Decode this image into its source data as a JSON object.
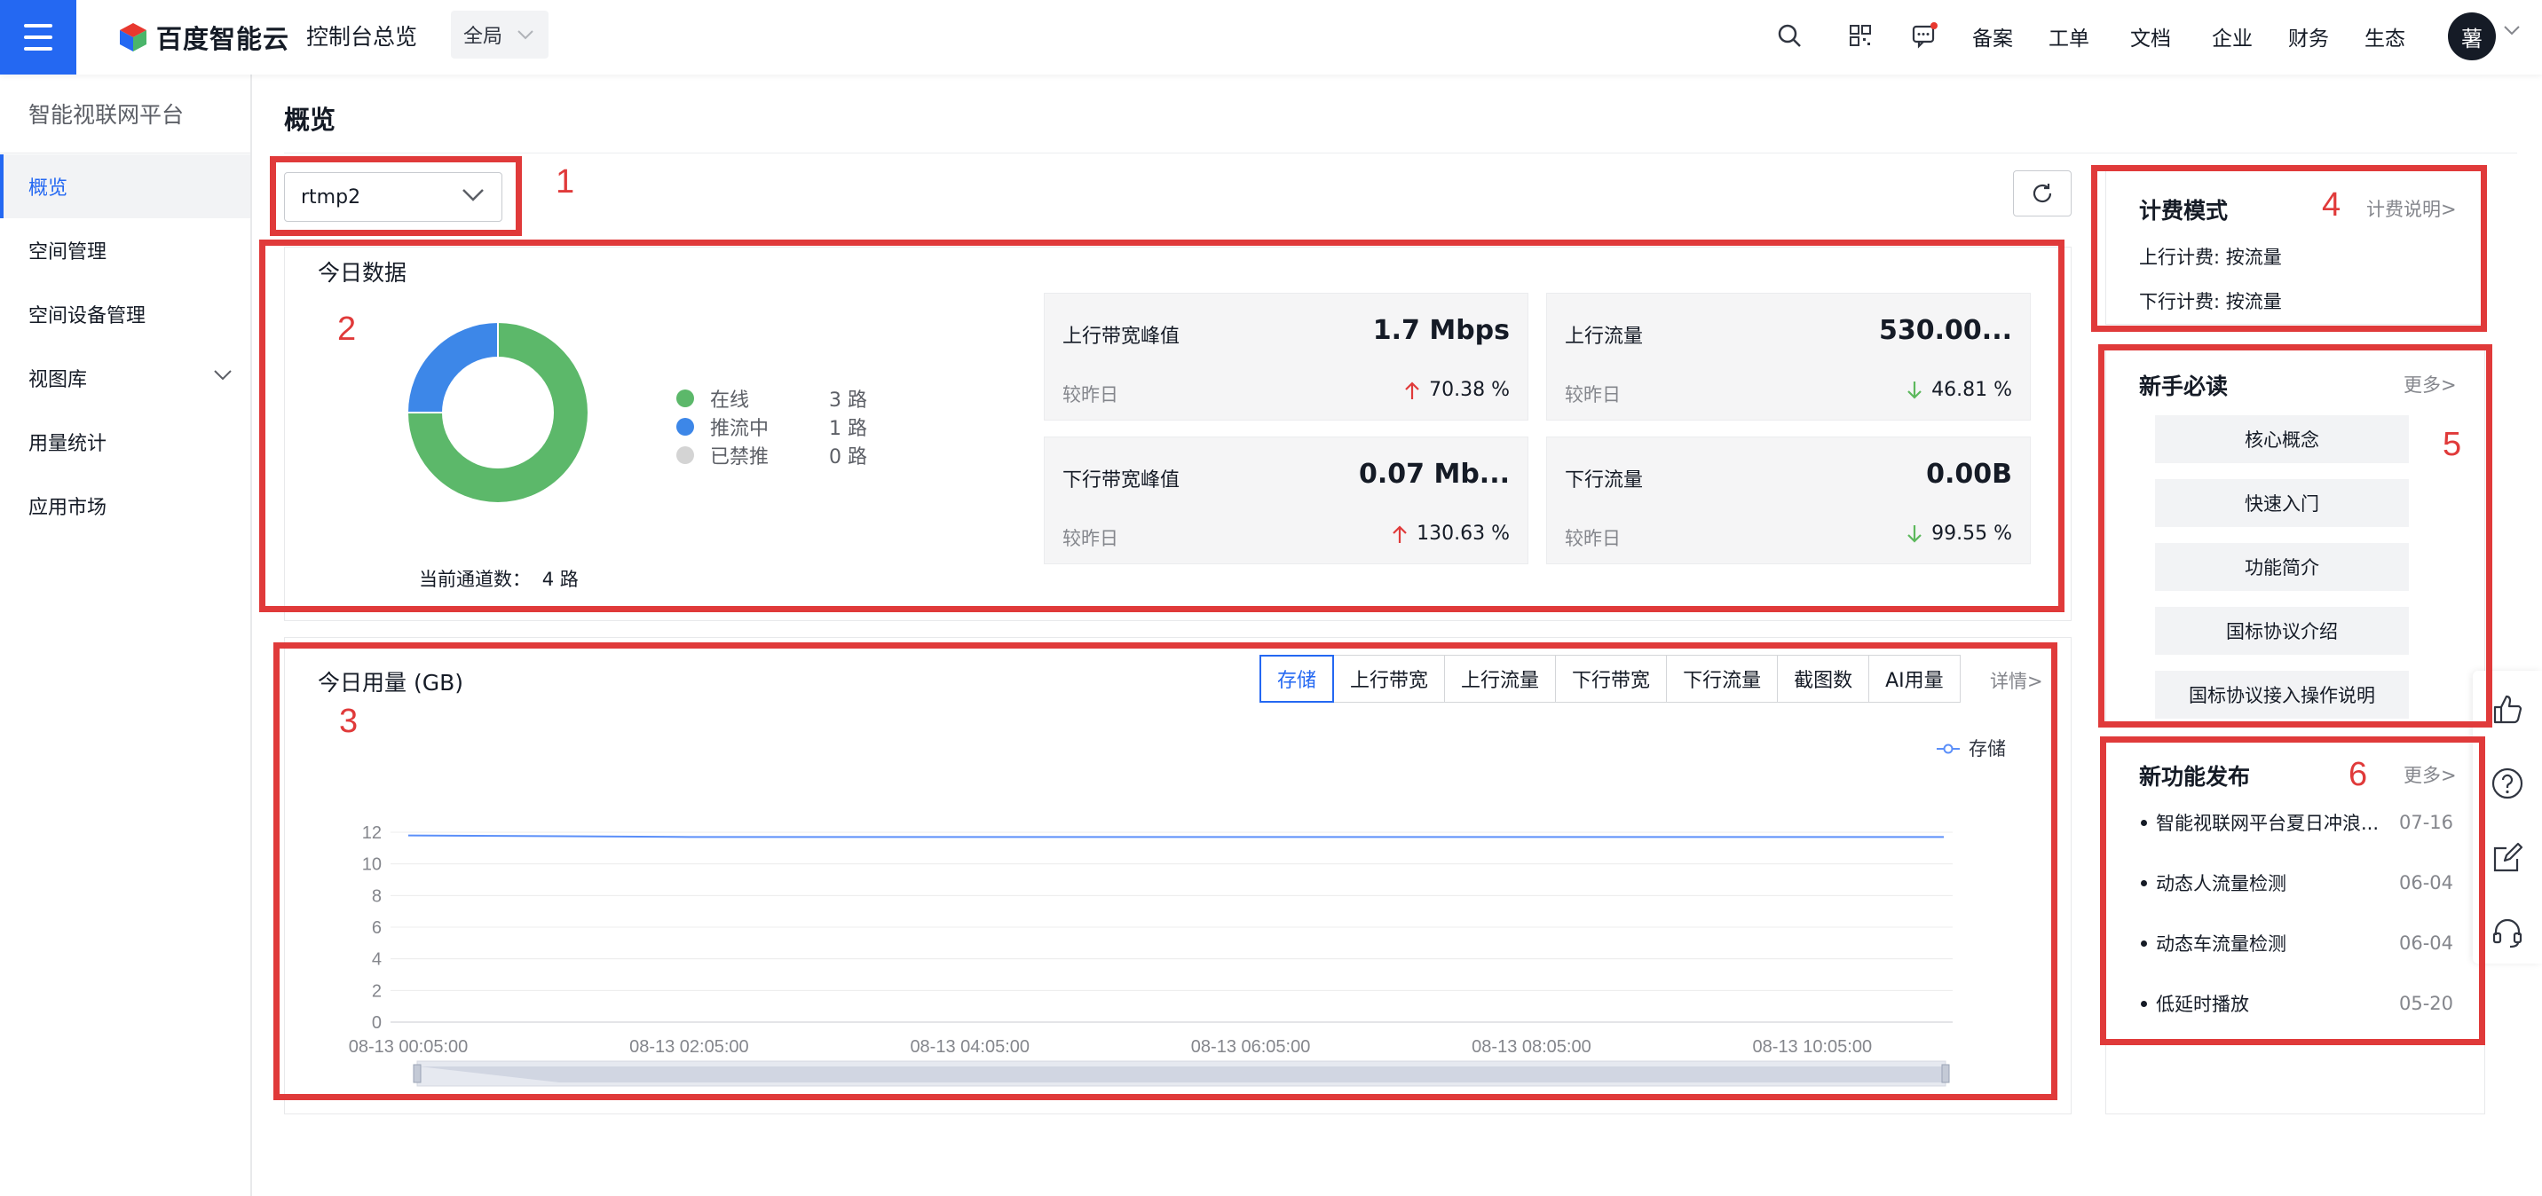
{
  "header": {
    "brand": "百度智能云",
    "console_link": "控制台总览",
    "region": "全局",
    "links": [
      "备案",
      "工单",
      "文档",
      "企业",
      "财务",
      "生态"
    ],
    "avatar_text": "薯"
  },
  "sidebar": {
    "title": "智能视联网平台",
    "items": [
      {
        "label": "概览"
      },
      {
        "label": "空间管理"
      },
      {
        "label": "空间设备管理"
      },
      {
        "label": "视图库"
      },
      {
        "label": "用量统计"
      },
      {
        "label": "应用市场"
      }
    ]
  },
  "page": {
    "title": "概览",
    "channel_select": "rtmp2"
  },
  "annotations": [
    "1",
    "2",
    "3",
    "4",
    "5",
    "6"
  ],
  "today_data": {
    "title": "今日数据",
    "legend": [
      {
        "label": "在线",
        "value": "3 路",
        "color": "#5cb86a",
        "count": 3
      },
      {
        "label": "推流中",
        "value": "1 路",
        "color": "#3d87e8",
        "count": 1
      },
      {
        "label": "已禁推",
        "value": "0 路",
        "color": "#d4d4d4",
        "count": 0
      }
    ],
    "channel_count_label": "当前通道数：",
    "channel_count_value": "4 路",
    "metrics": [
      {
        "label": "上行带宽峰值",
        "value": "1.7 Mbps",
        "compare": "较昨日",
        "pct": "70.38 %",
        "trend": "up"
      },
      {
        "label": "上行流量",
        "value": "530.00...",
        "compare": "较昨日",
        "pct": "46.81 %",
        "trend": "down"
      },
      {
        "label": "下行带宽峰值",
        "value": "0.07 Mb...",
        "compare": "较昨日",
        "pct": "130.63 %",
        "trend": "up"
      },
      {
        "label": "下行流量",
        "value": "0.00B",
        "compare": "较昨日",
        "pct": "99.55 %",
        "trend": "down"
      }
    ]
  },
  "usage": {
    "title": "今日用量 (GB)",
    "tabs": [
      "存储",
      "上行带宽",
      "上行流量",
      "下行带宽",
      "下行流量",
      "截图数",
      "AI用量"
    ],
    "active_tab": 0,
    "detail_link": "详情>"
  },
  "chart_data": {
    "type": "line",
    "title": "今日用量 (GB)",
    "xlabel": "",
    "ylabel": "",
    "x": [
      "08-13 00:05:00",
      "08-13 02:05:00",
      "08-13 04:05:00",
      "08-13 06:05:00",
      "08-13 08:05:00",
      "08-13 10:05:00",
      "08-13 11:05:00"
    ],
    "x_ticks": [
      "08-13 00:05:00",
      "08-13 02:05:00",
      "08-13 04:05:00",
      "08-13 06:05:00",
      "08-13 08:05:00",
      "08-13 10:05:00"
    ],
    "series": [
      {
        "name": "存储",
        "values": [
          11.8,
          11.7,
          11.7,
          11.7,
          11.7,
          11.7,
          11.7
        ],
        "color": "#5b8ff9"
      }
    ],
    "yticks": [
      "0",
      "2",
      "4",
      "6",
      "8",
      "10",
      "12"
    ],
    "ylim": [
      0,
      12
    ],
    "grid": true,
    "legend": "top-right",
    "datazoom": true
  },
  "billing": {
    "title": "计费模式",
    "link": "计费说明>",
    "up": "上行计费: 按流量",
    "down": "下行计费: 按流量"
  },
  "guide": {
    "title": "新手必读",
    "more": "更多>",
    "items": [
      "核心概念",
      "快速入门",
      "功能简介",
      "国标协议介绍",
      "国标协议接入操作说明"
    ]
  },
  "news": {
    "title": "新功能发布",
    "more": "更多>",
    "items": [
      {
        "title": "智能视联网平台夏日冲浪...",
        "date": "07-16"
      },
      {
        "title": "动态人流量检测",
        "date": "06-04"
      },
      {
        "title": "动态车流量检测",
        "date": "06-04"
      },
      {
        "title": "低延时播放",
        "date": "05-20"
      }
    ]
  },
  "colors": {
    "accent": "#2468f2",
    "annotation": "#e03a3a",
    "up_arrow": "#e03a3a",
    "down_arrow": "#5cb85c"
  }
}
